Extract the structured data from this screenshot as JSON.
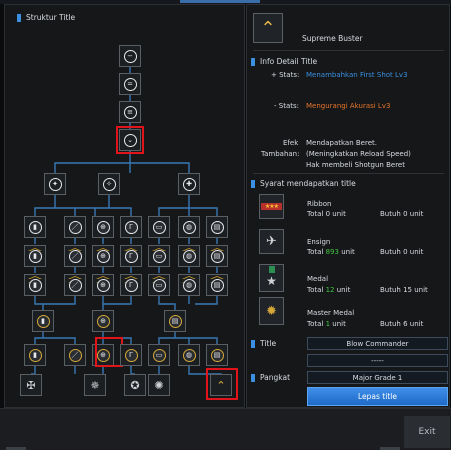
{
  "left_panel": {
    "title": "Struktur Title"
  },
  "selected_title": {
    "name": "Supreme Buster"
  },
  "info_detail": {
    "header": "Info Detail Title",
    "plus_label": "+ Stats:",
    "plus_value": "Menambahkan First Shot Lv3",
    "minus_label": "- Stats:",
    "minus_value": "Mengurangi Akurasi Lv3",
    "effect_label_1": "Efek",
    "effect_label_2": "Tambahan:",
    "effect_lines": [
      "Mendapatkan Beret.",
      "(Meningkatkan Reload Speed)",
      "Hak membeli Shotgun Beret"
    ]
  },
  "requirements": {
    "header": "Syarat mendapatkan title",
    "items": [
      {
        "name": "Ribbon",
        "total_label": "Total",
        "total": "0",
        "unit": "unit",
        "need": "Butuh 0 unit"
      },
      {
        "name": "Ensign",
        "total_label": "Total",
        "total": "893",
        "unit": "unit",
        "need": "Butuh 0 unit"
      },
      {
        "name": "Medal",
        "total_label": "Total",
        "total": "12",
        "unit": "unit",
        "need": "Butuh 15 unit"
      },
      {
        "name": "Master Medal",
        "total_label": "Total",
        "total": "1",
        "unit": "unit",
        "need": "Butuh 6 unit"
      }
    ]
  },
  "title_section": {
    "label": "Title",
    "value": "Blow Commander",
    "slot2": "-----"
  },
  "rank_section": {
    "label": "Pangkat",
    "value": "Major Grade 1"
  },
  "actions": {
    "release": "Lepas title",
    "exit": "Exit"
  },
  "colors": {
    "accent": "#3b8fe0",
    "positive": "#3b8fe0",
    "negative": "#e8742a",
    "highlight": "#e0141b",
    "green": "#3fc43f",
    "button": "#2a7ad8"
  }
}
